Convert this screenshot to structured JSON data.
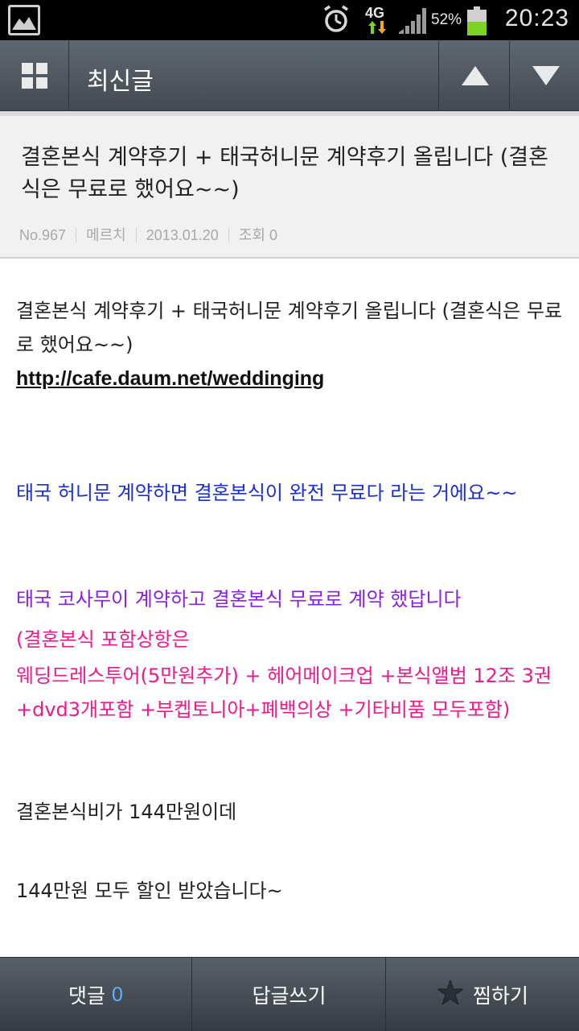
{
  "status": {
    "network": "4G",
    "battery_percent_text": "52%",
    "battery_level": 0.52,
    "time": "20:23",
    "battery_color": "#7dd321"
  },
  "appbar": {
    "title": "최신글",
    "icons": [
      "grid-icon",
      "arrow-up-icon",
      "arrow-down-icon"
    ]
  },
  "post": {
    "title": "결혼본식 계약후기 + 태국허니문 계약후기 올립니다 (결혼식은 무료로 했어요~~)",
    "meta": {
      "number": "No.967",
      "author": "메르치",
      "date": "2013.01.20",
      "views": "조회 0"
    },
    "body": {
      "p1": "결혼본식 계약후기 + 태국허니문 계약후기 올립니다 (결혼식은 무료로 했어요~~)",
      "link": "http://cafe.daum.net/weddinging",
      "blue": "태국 허니문 계약하면 결혼본식이 완전 무료다 라는 거에요~~",
      "purple": "태국 코사무이 계약하고 결혼본식 무료로 계약 했답니다",
      "pink1": "(결혼본식 포함상항은",
      "pink2": " 웨딩드레스투어(5만원추가) + 헤어메이크업 +본식앨범 12조 3권 +dvd3개포함 +부켑토니아+폐백의상 +기타비품 모두포함)",
      "pa": "결혼본식비가 144만원이데",
      "pb": "144만원 모두 할인 받았습니다~"
    },
    "colors": {
      "blue": "#1b2fd6",
      "purple": "#8a1fe8",
      "pink": "#f0198a"
    }
  },
  "bottombar": {
    "comment_label": "댓글",
    "comment_count": "0",
    "reply_label": "답글쓰기",
    "favorite_label": "찜하기"
  }
}
